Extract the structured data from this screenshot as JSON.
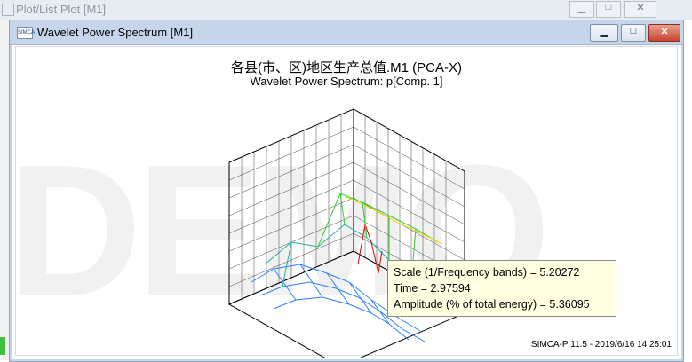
{
  "background_window": {
    "title": "Plot/List Plot [M1]",
    "caption_buttons": {
      "minimize": "▁",
      "maximize": "□",
      "close": "✕"
    }
  },
  "window": {
    "title": "Wavelet Power Spectrum [M1]",
    "icon_text": "SIMCA",
    "caption_buttons": {
      "minimize": "▁",
      "maximize": "□",
      "close": "✕"
    }
  },
  "watermark": "DEMO",
  "plot": {
    "title": "各县(市、区)地区生产总值.M1 (PCA-X)",
    "subtitle": "Wavelet Power Spectrum: p[Comp. 1]"
  },
  "tooltip": {
    "scale": "Scale (1/Frequency bands) = 5.20272",
    "time": "Time = 2.97594",
    "amplitude": "Amplitude (% of total energy) = 5.36095"
  },
  "footer": "SIMCA-P 11.5 - 2019/6/16 14:25:01",
  "colors": {
    "grid": "#000000",
    "surface_low": "#2a7fff",
    "surface_mid": "#33cc33",
    "surface_high": "#ffd700",
    "peak": "#e00000",
    "tooltip_bg": "#ffffe1"
  }
}
